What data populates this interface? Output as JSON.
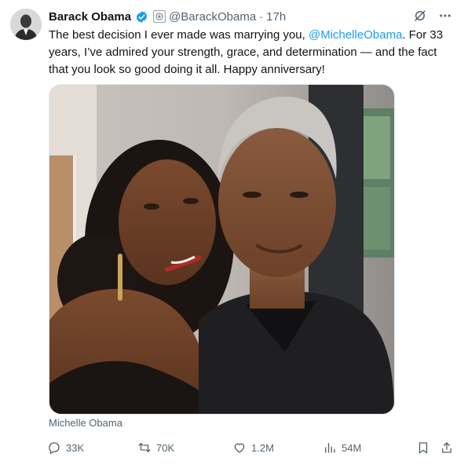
{
  "author": {
    "name": "Barack Obama",
    "handle": "@BarackObama",
    "separator": "·",
    "time": "17h"
  },
  "tweet": {
    "text_part1": "The best decision I ever made was marrying you, ",
    "mention": "@MichelleObama",
    "text_part2": ". For 33 years, I’ve admired your strength, grace, and determination — and the fact that you look so good doing it all. Happy anniversary!"
  },
  "media": {
    "tag": "Michelle Obama"
  },
  "stats": {
    "replies": "33K",
    "reposts": "70K",
    "likes": "1.2M",
    "views": "54M"
  },
  "colors": {
    "accent": "#1d9bf0",
    "muted": "#536471"
  }
}
